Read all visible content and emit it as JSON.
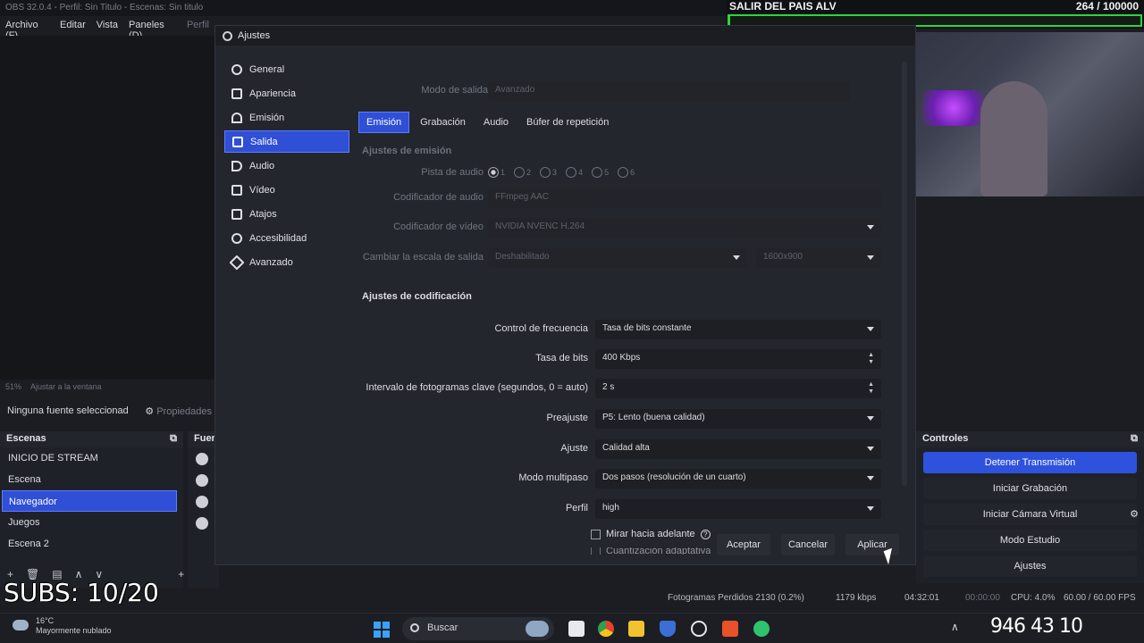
{
  "titlebar": {
    "text": "OBS 32.0.4 - Perfil: Sin Titulo - Escenas: Sin titulo"
  },
  "menubar": {
    "items": [
      "Archivo (F)",
      "Editar",
      "Vista",
      "Paneles (D)",
      "Perfil"
    ]
  },
  "preview": {
    "scale_label": "51%",
    "fit_label": "Ajustar a la ventana"
  },
  "source_bar": {
    "none_selected": "Ninguna fuente seleccionad",
    "properties": "Propiedades"
  },
  "scenes": {
    "header": "Escenas",
    "items": [
      "INICIO DE STREAM",
      "Escena",
      "Navegador",
      "Juegos",
      "Escena 2"
    ],
    "selected_index": 2
  },
  "sources": {
    "header": "Fuentes"
  },
  "controls": {
    "header": "Controles",
    "buttons": [
      "Detener Transmisión",
      "Iniciar Grabación",
      "Iniciar Cámara Virtual",
      "Modo Estudio",
      "Ajustes"
    ]
  },
  "statusbar": {
    "dropped_frames": "Fotogramas Perdidos 2130 (0.2%)",
    "bitrate": "1179 kbps",
    "stream_time": "04:32:01",
    "record_time": "00:00:00",
    "cpu": "CPU: 4.0%",
    "fps": "60.00 / 60.00 FPS"
  },
  "overlay": {
    "goal_title": "SALIR DEL PAIS ALV",
    "goal_count": "264 / 100000",
    "goal_progress": 0.00264,
    "subs": "SUBS: 10/20"
  },
  "settings": {
    "title": "Ajustes",
    "nav": [
      "General",
      "Apariencia",
      "Emisión",
      "Salida",
      "Audio",
      "Vídeo",
      "Atajos",
      "Accesibilidad",
      "Avanzado"
    ],
    "nav_selected": 3,
    "output_mode_label": "Modo de salida",
    "output_mode_value": "Avanzado",
    "tabs": [
      "Emisión",
      "Grabación",
      "Audio",
      "Búfer de repetición"
    ],
    "tab_selected": 0,
    "stream_section": "Ajustes de emisión",
    "audio_track_label": "Pista de audio",
    "audio_tracks": [
      "1",
      "2",
      "3",
      "4",
      "5",
      "6"
    ],
    "audio_encoder_label": "Codificador de audio",
    "audio_encoder_value": "FFmpeg AAC",
    "video_encoder_label": "Codificador de vídeo",
    "video_encoder_value": "NVIDIA NVENC H.264",
    "rescale_label": "Cambiar la escala de salida",
    "rescale_value": "Deshabilitado",
    "rescale_res": "1600x900",
    "encoder_section": "Ajustes de codificación",
    "rate_control_label": "Control de frecuencia",
    "rate_control_value": "Tasa de bits constante",
    "bitrate_label": "Tasa de bits",
    "bitrate_value": "400 Kbps",
    "keyframe_label": "Intervalo de fotogramas clave (segundos, 0 = auto)",
    "keyframe_value": "2 s",
    "preset_label": "Preajuste",
    "preset_value": "P5: Lento (buena calidad)",
    "tuning_label": "Ajuste",
    "tuning_value": "Calidad alta",
    "multipass_label": "Modo multipaso",
    "multipass_value": "Dos pasos (resolución de un cuarto)",
    "profile_label": "Perfil",
    "profile_value": "high",
    "lookahead_label": "Mirar hacia adelante",
    "aq_label": "Cuantización adaptativa",
    "buttons": {
      "accept": "Aceptar",
      "cancel": "Cancelar",
      "apply": "Aplicar"
    }
  },
  "taskbar": {
    "weather_temp": "16°C",
    "weather_desc": "Mayormente nublado",
    "search": "Buscar",
    "clock": "946 43 10"
  }
}
